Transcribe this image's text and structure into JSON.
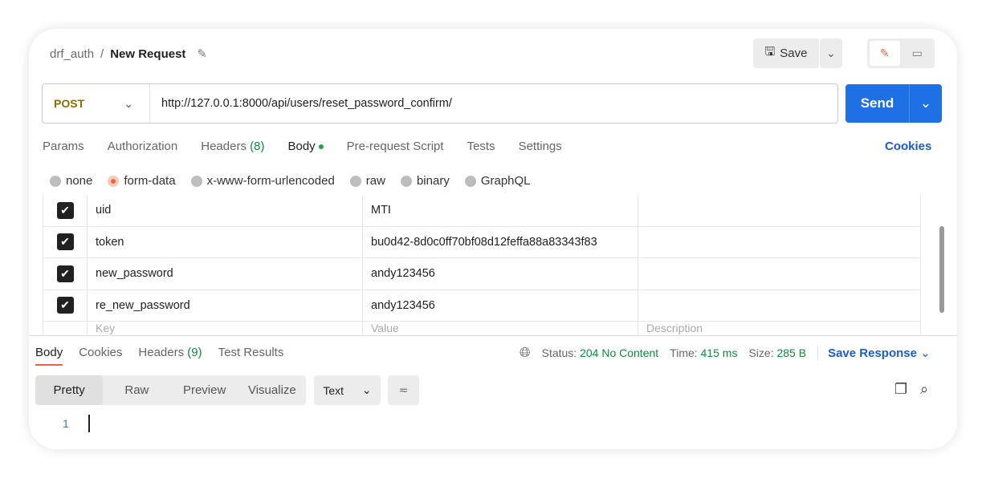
{
  "header": {
    "collection": "drf_auth",
    "separator": "/",
    "request_name": "New Request",
    "save_label": "Save"
  },
  "request": {
    "method": "POST",
    "url": "http://127.0.0.1:8000/api/users/reset_password_confirm/",
    "send_label": "Send"
  },
  "tabs": [
    {
      "label": "Params"
    },
    {
      "label": "Authorization"
    },
    {
      "label": "Headers",
      "count": "(8)"
    },
    {
      "label": "Body"
    },
    {
      "label": "Pre-request Script"
    },
    {
      "label": "Tests"
    },
    {
      "label": "Settings"
    }
  ],
  "cookies_label": "Cookies",
  "body_types": [
    {
      "label": "none"
    },
    {
      "label": "form-data",
      "selected": true
    },
    {
      "label": "x-www-form-urlencoded"
    },
    {
      "label": "raw"
    },
    {
      "label": "binary"
    },
    {
      "label": "GraphQL"
    }
  ],
  "form_rows": [
    {
      "key": "uid",
      "value": "MTI",
      "checked": true
    },
    {
      "key": "token",
      "value": "bu0d42-8d0c0ff70bf08d12feffa88a83343f83",
      "checked": true
    },
    {
      "key": "new_password",
      "value": "andy123456",
      "checked": true
    },
    {
      "key": "re_new_password",
      "value": "andy123456",
      "checked": true
    }
  ],
  "placeholders": {
    "key": "Key",
    "value": "Value",
    "description": "Description"
  },
  "response": {
    "tabs": [
      {
        "label": "Body"
      },
      {
        "label": "Cookies"
      },
      {
        "label": "Headers",
        "count": "(9)"
      },
      {
        "label": "Test Results"
      }
    ],
    "status_label": "Status:",
    "status": "204 No Content",
    "time_label": "Time:",
    "time": "415 ms",
    "size_label": "Size:",
    "size": "285 B",
    "save_response": "Save Response",
    "views": [
      "Pretty",
      "Raw",
      "Preview",
      "Visualize"
    ],
    "format": "Text",
    "line_number": "1"
  },
  "colors": {
    "accent": "#1f6fe5",
    "status_green": "#0f8a3a",
    "method": "#8a6d00",
    "active_tab": "#e8643a"
  }
}
